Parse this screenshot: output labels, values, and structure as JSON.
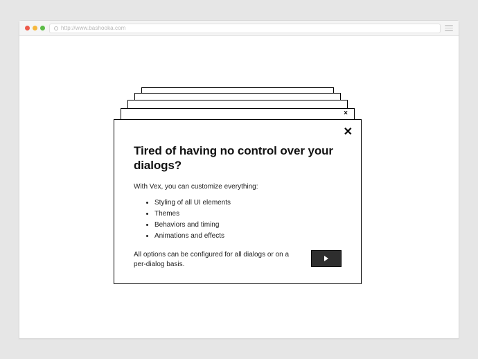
{
  "browser": {
    "url": "http://www.bashooka.com"
  },
  "dialog": {
    "close_glyph": "✕",
    "title": "Tired of having no control over your dialogs?",
    "intro": "With Vex, you can customize everything:",
    "items": [
      "Styling of all UI elements",
      "Themes",
      "Behaviors and timing",
      "Animations and effects"
    ],
    "footnote": "All options can be configured for all dialogs or on a per-dialog basis."
  }
}
